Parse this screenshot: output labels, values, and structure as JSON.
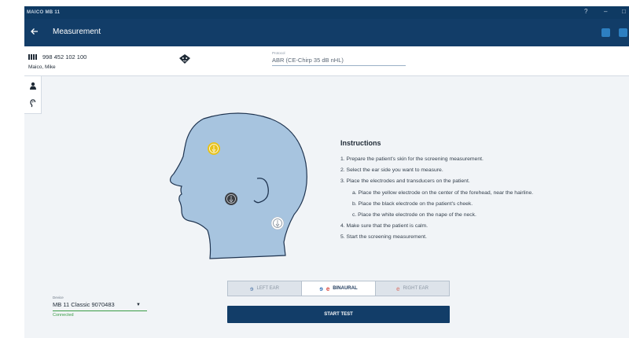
{
  "window": {
    "title": "MAICO  MB 11",
    "help": "?",
    "minimize": "–",
    "maximize": "□"
  },
  "header": {
    "back_icon": "arrow-left-icon",
    "title": "Measurement",
    "actions": [
      "print-icon",
      "save-icon"
    ]
  },
  "patient": {
    "id": "998 452 102 100",
    "name": "Maico, Mike",
    "protocol_label": "Protocol",
    "protocol_value": "ABR (CE-Chirp 35 dB nHL)"
  },
  "side_tabs": [
    "patient-icon",
    "ear-icon"
  ],
  "instructions": {
    "title": "Instructions",
    "steps": [
      "1. Prepare the patient's skin for the screening measurement.",
      "2. Select the ear side you want to measure.",
      "3. Place the electrodes and transducers on the patient.",
      "a. Place the yellow electrode on the center of the forehead, near the hairline.",
      "b. Place the black electrode on the patient's cheek.",
      "c. Place the white electrode on the nape of the neck.",
      "4. Make sure that the patient is calm.",
      "5. Start the screening measurement."
    ]
  },
  "device": {
    "label": "Device",
    "value": "MB 11 Classic 9070483",
    "status": "Connected"
  },
  "ear_selector": {
    "left": "LEFT EAR",
    "binaural": "BINAURAL",
    "right": "RIGHT EAR",
    "selected": "BINAURAL"
  },
  "start_button": "START TEST",
  "colors": {
    "header": "#123d68",
    "head_fill": "#a7c4df",
    "yellow_electrode": "#e8c21a",
    "left_ear": "#2e6db4",
    "right_ear": "#d8453b",
    "connected": "#3a9c46"
  }
}
